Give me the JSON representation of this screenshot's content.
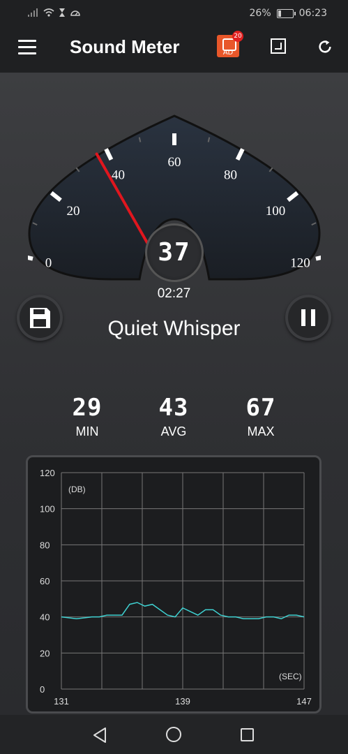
{
  "status_bar": {
    "battery": "26%",
    "time": "06:23",
    "battery_level": 0.26
  },
  "header": {
    "title": "Sound Meter",
    "ad_badge": "20",
    "ad_label": "AD"
  },
  "gauge": {
    "scale_labels": [
      "0",
      "20",
      "40",
      "60",
      "80",
      "100",
      "120"
    ],
    "min": 0,
    "max": 120,
    "needle_value": 37,
    "reading": "37"
  },
  "timer": "02:27",
  "level_label": "Quiet Whisper",
  "stats": {
    "min": {
      "value": "29",
      "label": "MIN"
    },
    "avg": {
      "value": "43",
      "label": "AVG"
    },
    "max": {
      "value": "67",
      "label": "MAX"
    }
  },
  "chart_data": {
    "type": "line",
    "ylabel": "(DB)",
    "xlabel": "(SEC)",
    "ylim": [
      0,
      120
    ],
    "xlim": [
      131,
      147
    ],
    "y_ticks": [
      "0",
      "20",
      "40",
      "60",
      "80",
      "100",
      "120"
    ],
    "x_ticks": [
      "131",
      "139",
      "147"
    ],
    "series": [
      {
        "color": "#3fd1d1",
        "x": [
          131,
          132,
          133,
          133.5,
          134,
          135,
          135.5,
          136,
          136.5,
          137,
          137.5,
          138,
          138.5,
          139,
          139.5,
          140,
          140.5,
          141,
          141.5,
          142,
          142.5,
          143,
          143.5,
          144,
          144.5,
          145,
          145.5,
          146,
          146.5,
          147
        ],
        "y": [
          40,
          39,
          40,
          40,
          41,
          41,
          47,
          48,
          46,
          47,
          44,
          41,
          40,
          45,
          43,
          41,
          44,
          44,
          41,
          40,
          40,
          39,
          39,
          39,
          40,
          40,
          39,
          41,
          41,
          40
        ]
      }
    ]
  },
  "colors": {
    "accent": "#3fd1d1",
    "needle": "#e0161e",
    "ad_button": "#e8572a"
  }
}
